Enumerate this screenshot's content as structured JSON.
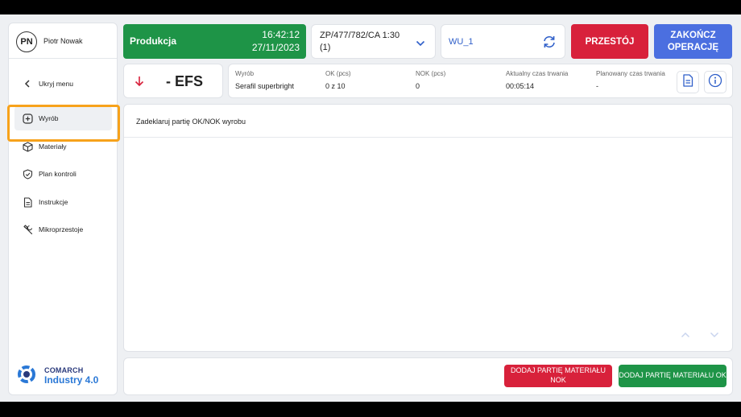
{
  "user": {
    "initials": "PN",
    "name": "Piotr Nowak"
  },
  "sidebar": {
    "items": [
      {
        "label": "Ukryj menu",
        "icon": "chevron-left-icon"
      },
      {
        "label": "Wyrób",
        "icon": "plus-square-icon",
        "active": true
      },
      {
        "label": "Materiały",
        "icon": "cube-icon"
      },
      {
        "label": "Plan kontroli",
        "icon": "shield-check-icon"
      },
      {
        "label": "Instrukcje",
        "icon": "document-icon"
      },
      {
        "label": "Mikroprzestoje",
        "icon": "wrench-icon"
      }
    ]
  },
  "brand": {
    "top": "COMARCH",
    "bottom": "Industry 4.0"
  },
  "header": {
    "status_label": "Produkcja",
    "time": "16:42:12",
    "date": "27/11/2023",
    "order": "ZP/477/782/CA 1:30 (1)",
    "workstation": "WU_1",
    "downtime_button": "PRZESTÓJ",
    "finish_button": "ZAKOŃCZ OPERACJĘ"
  },
  "operation": {
    "code": "- EFS"
  },
  "info": {
    "product_label": "Wyrób",
    "product_value": "Serafil superbright",
    "ok_label": "OK (pcs)",
    "ok_value": "0 z 10",
    "nok_label": "NOK (pcs)",
    "nok_value": "0",
    "current_time_label": "Aktualny czas trwania",
    "current_time_value": "00:05:14",
    "planned_time_label": "Planowany czas trwania",
    "planned_time_value": "-"
  },
  "main": {
    "title": "Zadeklaruj partię OK/NOK wyrobu"
  },
  "actions": {
    "nok_button": "DODAJ PARTIĘ MATERIAŁU NOK",
    "ok_button": "DODAJ PARTIĘ MATERIAŁU OK"
  },
  "colors": {
    "green": "#1e9447",
    "red": "#d8213b",
    "blue": "#4b6fe0",
    "accent_link": "#2f5fc9",
    "highlight": "#f7a21b"
  }
}
